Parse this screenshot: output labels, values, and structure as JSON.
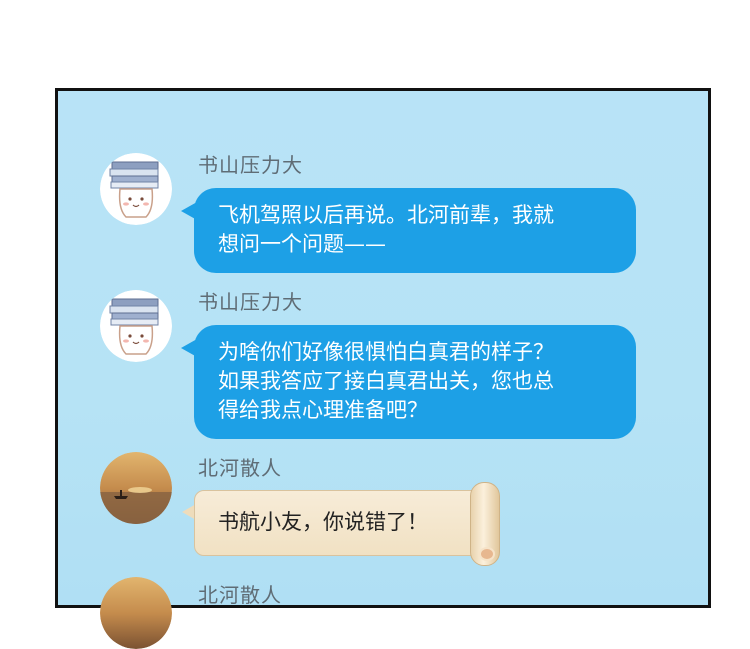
{
  "messages": [
    {
      "sender": "书山压力大",
      "avatar": "books-character-avatar",
      "lines": [
        "飞机驾照以后再说。北河前辈，我就",
        "想问一个问题——"
      ]
    },
    {
      "sender": "书山压力大",
      "avatar": "books-character-avatar",
      "lines": [
        "为啥你们好像很惧怕白真君的样子？",
        "如果我答应了接白真君出关，您也总",
        "得给我点心理准备吧？"
      ]
    },
    {
      "sender": "北河散人",
      "avatar": "sunset-lake-avatar",
      "text": "书航小友，你说错了！"
    },
    {
      "sender": "北河散人",
      "avatar": "sunset-lake-avatar"
    }
  ]
}
